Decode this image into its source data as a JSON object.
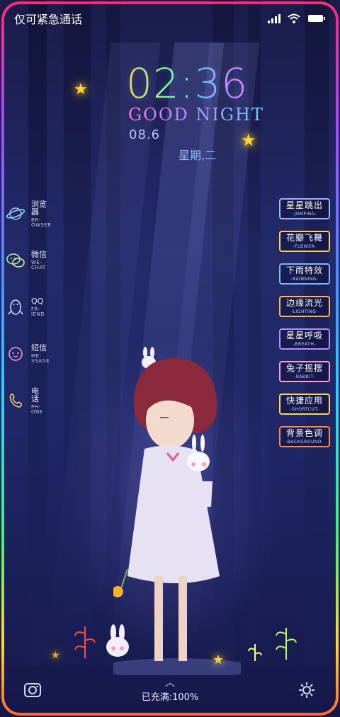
{
  "status_bar": {
    "carrier_text": "仅可紧急通话"
  },
  "clock": {
    "time": "02:36",
    "greeting": "GOOD NIGHT",
    "date": "08.6",
    "weekday": "星期,二"
  },
  "left_apps": [
    {
      "label": "浏览器",
      "sub": "BR-OWSER",
      "icon": "planet-icon"
    },
    {
      "label": "微信",
      "sub": "WE-CHAT",
      "icon": "wechat-icon"
    },
    {
      "label": "QQ",
      "sub": "FR-IEND",
      "icon": "penguin-icon"
    },
    {
      "label": "短信",
      "sub": "ME-SSAGE",
      "icon": "message-icon"
    },
    {
      "label": "电话",
      "sub": "PH-ONE",
      "icon": "phone-icon"
    }
  ],
  "right_buttons": [
    {
      "label": "星星跳出",
      "sub": "-JUMPING-"
    },
    {
      "label": "花瓣飞舞",
      "sub": "-FLOWER-"
    },
    {
      "label": "下雨特效",
      "sub": "-RAINNING-"
    },
    {
      "label": "边缘流光",
      "sub": "-LIGHTING-"
    },
    {
      "label": "星星呼吸",
      "sub": "-BREATH-"
    },
    {
      "label": "兔子摇摆",
      "sub": "-RABBIT-"
    },
    {
      "label": "快捷应用",
      "sub": "-SHORTCUT-"
    },
    {
      "label": "背景色调",
      "sub": "-BACKGROUND-"
    }
  ],
  "bottom": {
    "charge_text": "已充满:100%",
    "left_icon": "camera-icon",
    "right_icon": "gear-icon"
  },
  "colors": {
    "accent_blue": "#7ab8ff",
    "star_yellow": "#ffd63a",
    "frame_pink": "#ff2a7a"
  }
}
